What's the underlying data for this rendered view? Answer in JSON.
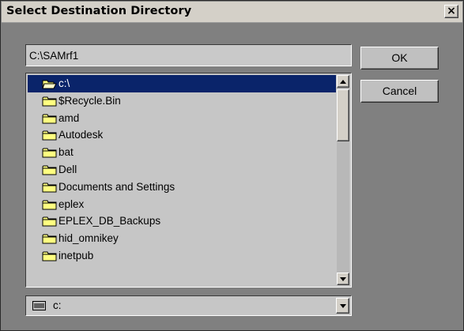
{
  "dialog": {
    "title": "Select Destination Directory",
    "close_glyph": "×"
  },
  "path_input": {
    "value": "C:\\SAMrf1"
  },
  "buttons": {
    "ok_label": "OK",
    "cancel_label": "Cancel"
  },
  "directory_list": {
    "items": [
      {
        "label": "c:\\",
        "icon": "open-folder-icon",
        "selected": true
      },
      {
        "label": "$Recycle.Bin",
        "icon": "folder-icon"
      },
      {
        "label": "amd",
        "icon": "folder-icon"
      },
      {
        "label": "Autodesk",
        "icon": "folder-icon"
      },
      {
        "label": "bat",
        "icon": "folder-icon"
      },
      {
        "label": "Dell",
        "icon": "folder-icon"
      },
      {
        "label": "Documents and Settings",
        "icon": "folder-icon"
      },
      {
        "label": "eplex",
        "icon": "folder-icon"
      },
      {
        "label": "EPLEX_DB_Backups",
        "icon": "folder-icon"
      },
      {
        "label": "hid_omnikey",
        "icon": "folder-icon"
      },
      {
        "label": "inetpub",
        "icon": "folder-icon"
      }
    ]
  },
  "drive_select": {
    "value": "c:",
    "icon": "drive-icon"
  },
  "colors": {
    "selection": "#0a246a",
    "folder": "#ffff80",
    "background": "#808080"
  }
}
